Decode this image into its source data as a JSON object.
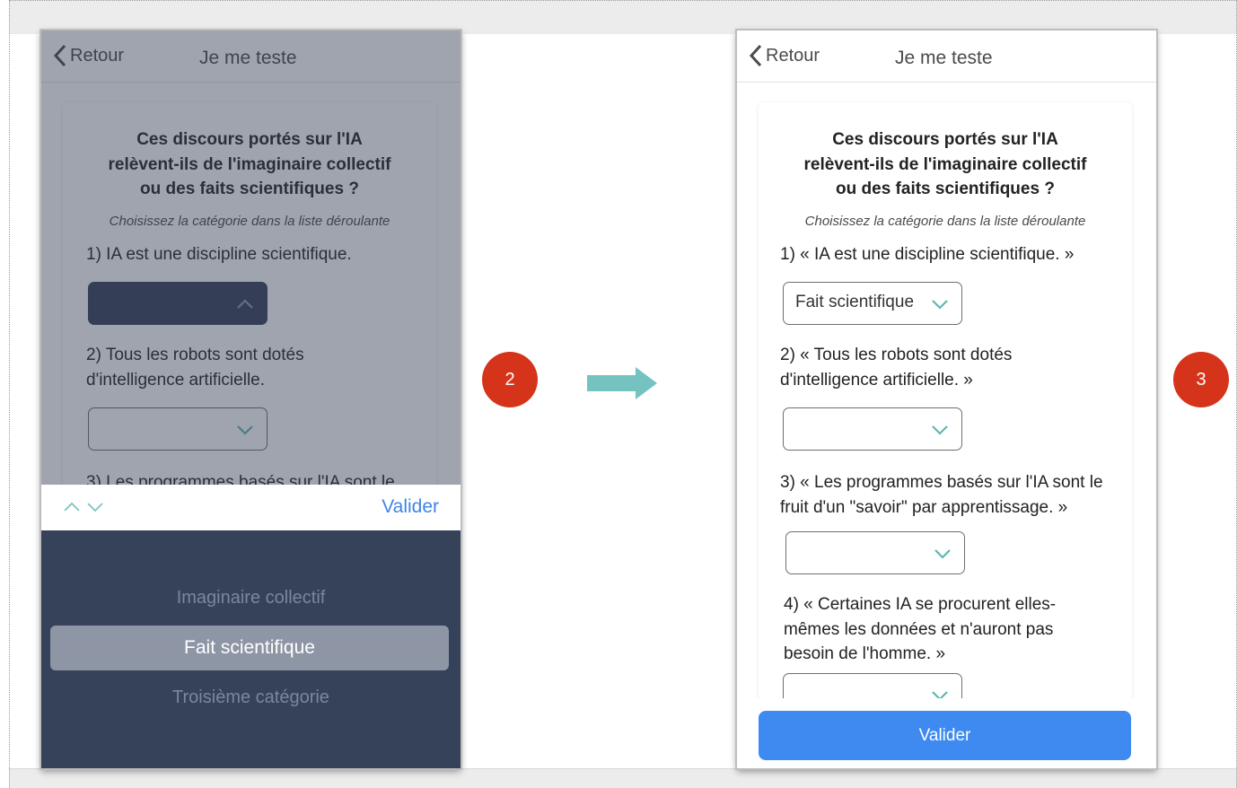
{
  "colors": {
    "accent": "#3e8af1",
    "badge": "#d6341a",
    "arrow": "#74c3c1",
    "picker": "#36415a"
  },
  "step_left": {
    "nav": {
      "back": "Retour",
      "title": "Je me teste"
    },
    "heading": [
      "Ces discours portés sur l'IA",
      "relèvent-ils de l'imaginaire collectif",
      "ou des faits scientifiques ?"
    ],
    "hint": "Choisissez la catégorie dans la liste déroulante",
    "q1": "1) IA est une discipline scientifique.",
    "q2": [
      "2) Tous les robots sont dotés",
      "d'intelligence artificielle."
    ],
    "q3": "3) Les programmes basés sur l'IA sont le",
    "picker": {
      "validate": "Valider",
      "options": [
        "Imaginaire collectif",
        "Fait scientifique",
        "Troisième catégorie"
      ],
      "selected": "Fait scientifique"
    }
  },
  "step_right": {
    "nav": {
      "back": "Retour",
      "title": "Je me teste"
    },
    "heading": [
      "Ces discours portés sur l'IA",
      "relèvent-ils de l'imaginaire collectif",
      "ou des faits scientifiques ?"
    ],
    "hint": "Choisissez la catégorie dans la liste déroulante",
    "q1": "1) « IA est une discipline scientifique. »",
    "q1_value": "Fait scientifique",
    "q2": [
      "2) « Tous les robots sont dotés",
      "d'intelligence artificielle. »"
    ],
    "q3": [
      "3) « Les programmes basés sur l'IA sont le",
      "fruit d'un \"savoir\" par apprentissage. »"
    ],
    "q4": [
      "4) « Certaines IA se procurent elles-",
      "mêmes les données et n'auront pas",
      "besoin de l'homme. »"
    ],
    "validate": "Valider"
  },
  "badges": {
    "left": "2",
    "right": "3"
  },
  "icons": {
    "back": "chevron-left-icon",
    "dropdown": "chevron-down-icon",
    "step_arrow": "arrow-right-icon"
  }
}
